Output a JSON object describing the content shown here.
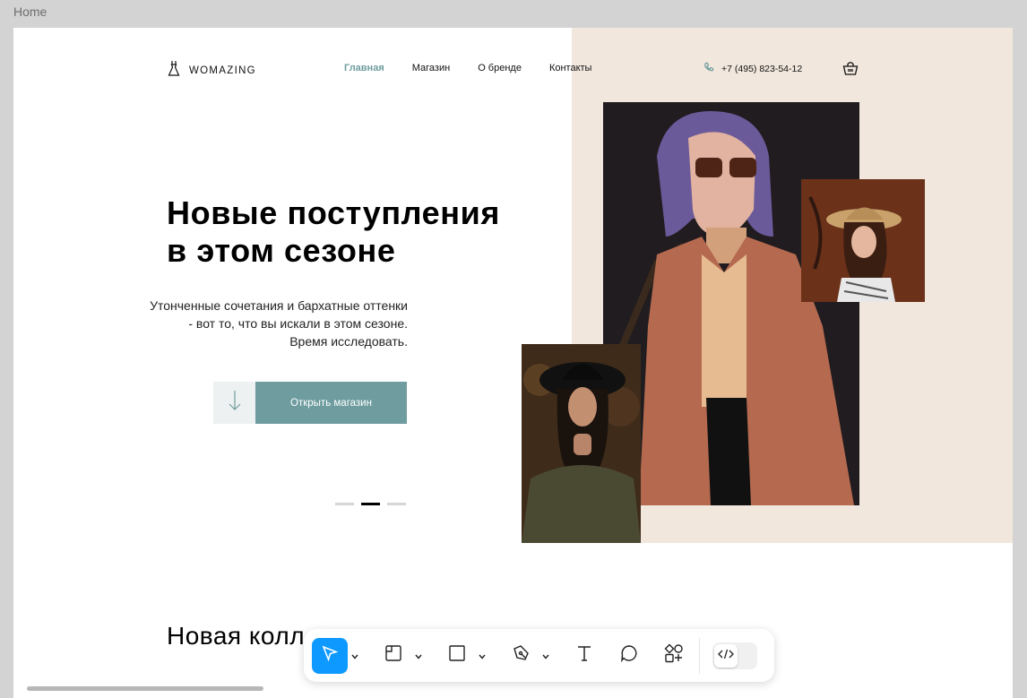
{
  "frame": {
    "label": "Home"
  },
  "header": {
    "logo_text": "WOMAZING",
    "nav": [
      "Главная",
      "Магазин",
      "О бренде",
      "Контакты"
    ],
    "phone": "+7 (495) 823-54-12"
  },
  "hero": {
    "title_line1": "Новые поступления",
    "title_line2": "в этом сезоне",
    "text": "Утонченные сочетания и бархатные оттенки - вот то, что вы искали в этом сезоне. Время исследовать.",
    "button_label": "Открыть магазин",
    "slider": {
      "count": 3,
      "active_index": 1
    }
  },
  "collection": {
    "title": "Новая колл"
  },
  "toolbar": {
    "tools": [
      "move-tool",
      "frame-tool",
      "shape-tool",
      "pen-tool",
      "text-tool",
      "comment-tool",
      "actions-tool"
    ],
    "active_tool": "move-tool",
    "dev_mode": false
  },
  "colors": {
    "accent": "#6e9c9f",
    "beige": "#f1e7dc",
    "toolbar_active": "#0d99ff"
  }
}
